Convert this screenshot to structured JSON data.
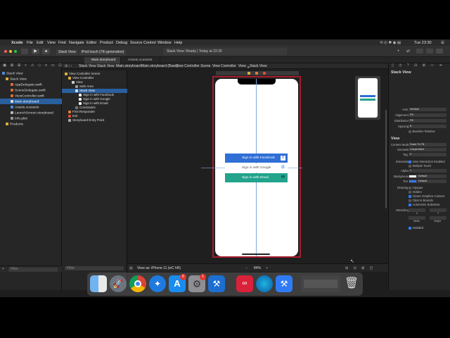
{
  "menubar": {
    "app": "Xcode",
    "items": [
      "File",
      "Edit",
      "View",
      "Find",
      "Navigate",
      "Editor",
      "Product",
      "Debug",
      "Source Control",
      "Window",
      "Help"
    ],
    "clock": "Tue 23:30"
  },
  "toolbar": {
    "scheme": "Stack View",
    "device": "iPod touch (7th generation)",
    "status": "Stack View: Ready | Today at 23:30"
  },
  "tabs": [
    "Main.storyboard",
    "Assets.xcassets"
  ],
  "navigator": {
    "project": "Stack View",
    "group": "Stack View",
    "files": [
      "AppDelegate.swift",
      "SceneDelegate.swift",
      "ViewController.swift",
      "Main.storyboard",
      "Assets.xcassets",
      "LaunchScreen.storyboard",
      "Info.plist"
    ],
    "products": "Products",
    "filter": "Filter"
  },
  "jumpbar": [
    "Stack View",
    "Stack View",
    "Main.storyboard",
    "Main.storyboard (Base)",
    "View Controller Scene",
    "View Controller",
    "View",
    "Stack View"
  ],
  "outline": {
    "scene": "View Controller Scene",
    "controller": "View Controller",
    "view": "View",
    "safe_area": "Safe Area",
    "stack_view": "Stack View",
    "items": [
      "Sign in with Facebook",
      "Sign in with Google",
      "Sign in with Email"
    ],
    "constraints": "Constraints",
    "first_responder": "First Responder",
    "exit": "Exit",
    "entry": "Storyboard Entry Point",
    "filter": "Filter"
  },
  "phone": {
    "buttons": [
      {
        "label": "Sign in with Facebook",
        "icon": "f",
        "color": "#2f6fd6"
      },
      {
        "label": "Sign in with Google",
        "icon": "G",
        "color": "#ffffff"
      },
      {
        "label": "Sign in with Email",
        "icon": "✉",
        "color": "#21a38c"
      }
    ]
  },
  "canvasbar": {
    "view_as": "View as: iPhone 11 (wC hR)",
    "zoom": "84%"
  },
  "inspector": {
    "section_stack": "Stack View",
    "axis": {
      "label": "Axis",
      "value": "Vertical"
    },
    "alignment": {
      "label": "Alignment",
      "value": "Fill"
    },
    "distribution": {
      "label": "Distribution",
      "value": "Fill"
    },
    "spacing": {
      "label": "Spacing",
      "value": "8"
    },
    "baseline": "Baseline Relative",
    "section_view": "View",
    "content_mode": {
      "label": "Content Mode",
      "value": "Scale To Fill"
    },
    "semantic": {
      "label": "Semantic",
      "value": "Unspecified"
    },
    "tag": {
      "label": "Tag",
      "value": "0"
    },
    "interaction": "Interaction",
    "user_interaction": "User Interaction Enabled",
    "multiple_touch": "Multiple Touch",
    "alpha": {
      "label": "Alpha",
      "value": "1"
    },
    "background": {
      "label": "Background",
      "value": "Default"
    },
    "tint": {
      "label": "Tint",
      "value": "Default"
    },
    "drawing": "Drawing",
    "opaque": "Opaque",
    "hidden": "Hidden",
    "clears": "Clears Graphics Context",
    "clips": "Clips to Bounds",
    "autoresize": "Autoresize Subviews",
    "stretching": "Stretching",
    "x": "X",
    "y": "Y",
    "width": "Width",
    "height": "Height",
    "installed": "Installed"
  },
  "dock": {
    "badge_appstore": "6",
    "badge_settings": "1"
  }
}
